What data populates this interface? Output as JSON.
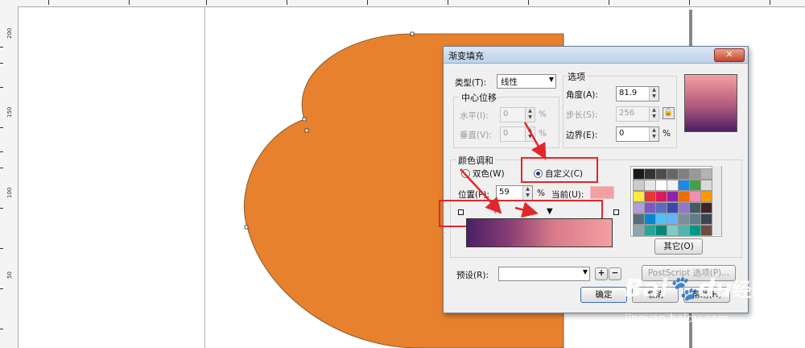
{
  "ruler": {
    "left_labels": [
      "200",
      "150",
      "100",
      "50"
    ]
  },
  "dialog": {
    "title": "渐变填充",
    "close_label": "✕",
    "type_label": "类型(T):",
    "type_value": "线性",
    "center_offset_label": "中心位移",
    "horizontal_label": "水平(I):",
    "horizontal_value": "0",
    "vertical_label": "垂直(V):",
    "vertical_value": "0",
    "percent": "%",
    "options_label": "选项",
    "angle_label": "角度(A):",
    "angle_value": "81.9",
    "steps_label": "步长(S):",
    "steps_value": "256",
    "border_label": "边界(E):",
    "border_value": "0",
    "color_blend_label": "颜色调和",
    "two_color_label": "双色(W)",
    "custom_label": "自定义(C)",
    "position_label": "位置(P):",
    "position_value": "59",
    "current_label": "当前(U):",
    "other_button": "其它(O)",
    "preset_label": "预设(R):",
    "preset_value": "",
    "postscript_button": "PostScript 选项(P)...",
    "ok_button": "确定",
    "cancel_button": "取消",
    "help_button": "帮助(H)"
  },
  "watermark": {
    "brand": "Bai",
    "paw": "du",
    "cn": "经验",
    "url": "jingyan.baidu.com"
  },
  "colors": {
    "shape_fill": "#e8812d",
    "current_color": "#f4a0a0"
  }
}
